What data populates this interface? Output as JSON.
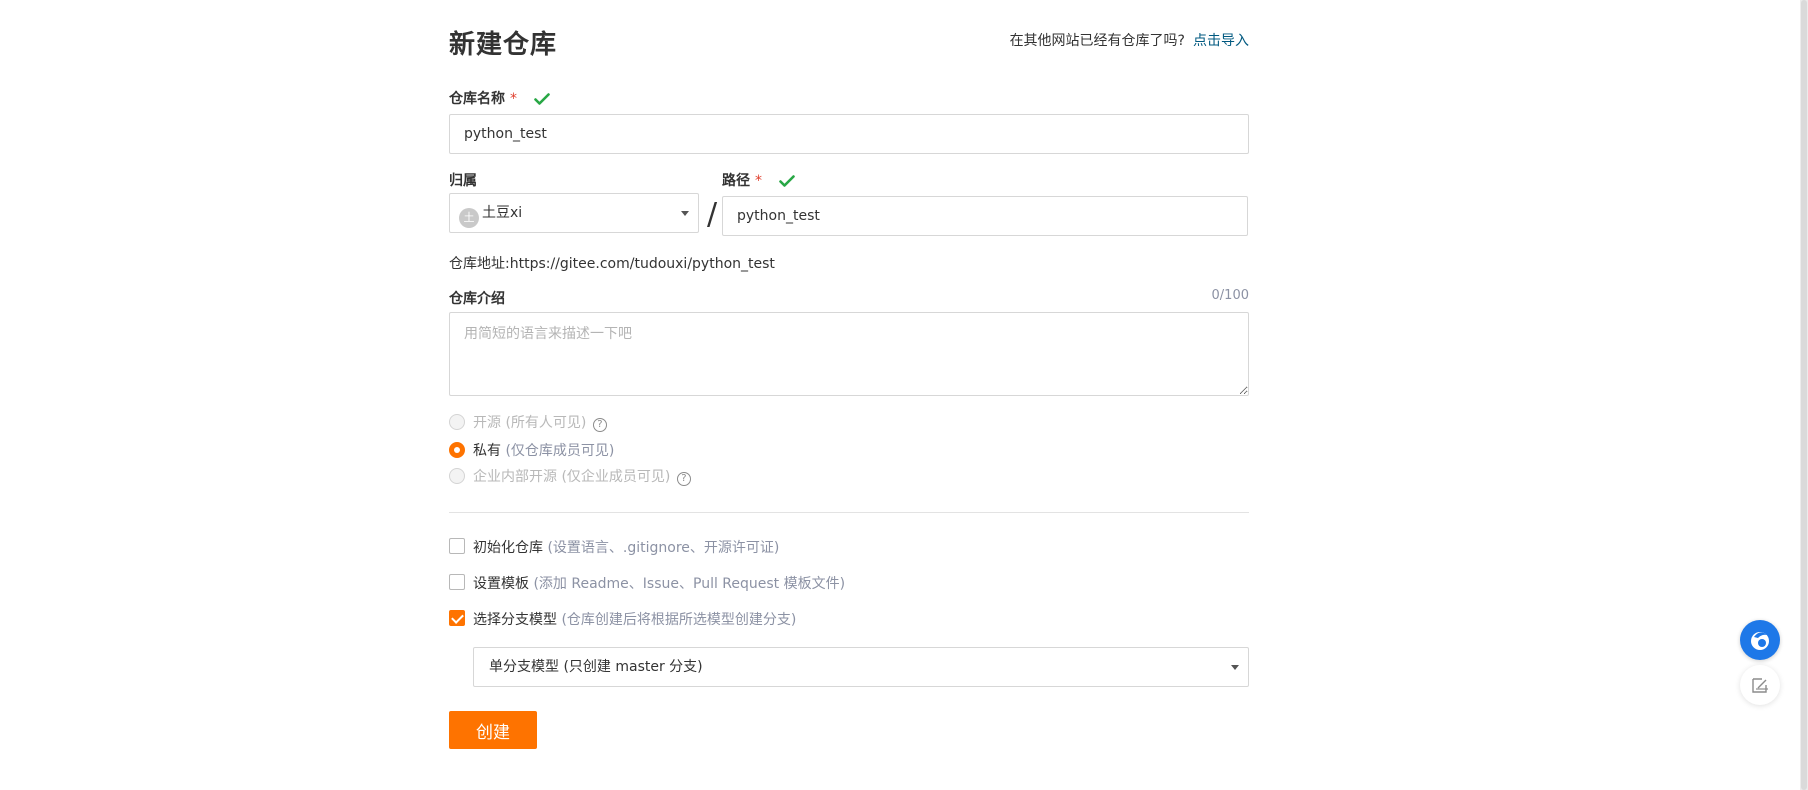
{
  "page": {
    "title": "新建仓库",
    "import_hint": "在其他网站已经有仓库了吗?",
    "import_link": "点击导入"
  },
  "repo_name": {
    "label": "仓库名称",
    "required_mark": "*",
    "value": "python_test"
  },
  "owner": {
    "label": "归属",
    "avatar_letter": "土",
    "value": "土豆xi"
  },
  "path": {
    "label": "路径",
    "required_mark": "*",
    "separator": "/",
    "value": "python_test"
  },
  "repo_url": "仓库地址:https://gitee.com/tudouxi/python_test",
  "description": {
    "label": "仓库介绍",
    "counter": "0/100",
    "placeholder": "用简短的语言来描述一下吧",
    "value": ""
  },
  "visibility": {
    "options": [
      {
        "label": "开源",
        "hint": "(所有人可见)",
        "selected": false,
        "disabled": true
      },
      {
        "label": "私有",
        "hint": "(仅仓库成员可见)",
        "selected": true,
        "disabled": false
      },
      {
        "label": "企业内部开源",
        "hint": "(仅企业成员可见)",
        "selected": false,
        "disabled": true
      }
    ]
  },
  "options": {
    "init_repo": {
      "label": "初始化仓库",
      "hint": "(设置语言、.gitignore、开源许可证)",
      "checked": false
    },
    "template": {
      "label": "设置模板",
      "hint": "(添加 Readme、Issue、Pull Request 模板文件)",
      "checked": false
    },
    "branch_model": {
      "label": "选择分支模型",
      "hint": "(仓库创建后将根据所选模型创建分支)",
      "checked": true
    }
  },
  "branch_model_select": {
    "value": "单分支模型 (只创建 master 分支)"
  },
  "create_button": "创建",
  "colors": {
    "accent": "#fe7300",
    "link": "#005980",
    "valid": "#28a745",
    "required": "#e03e2d",
    "help_button": "#1e78e8"
  }
}
